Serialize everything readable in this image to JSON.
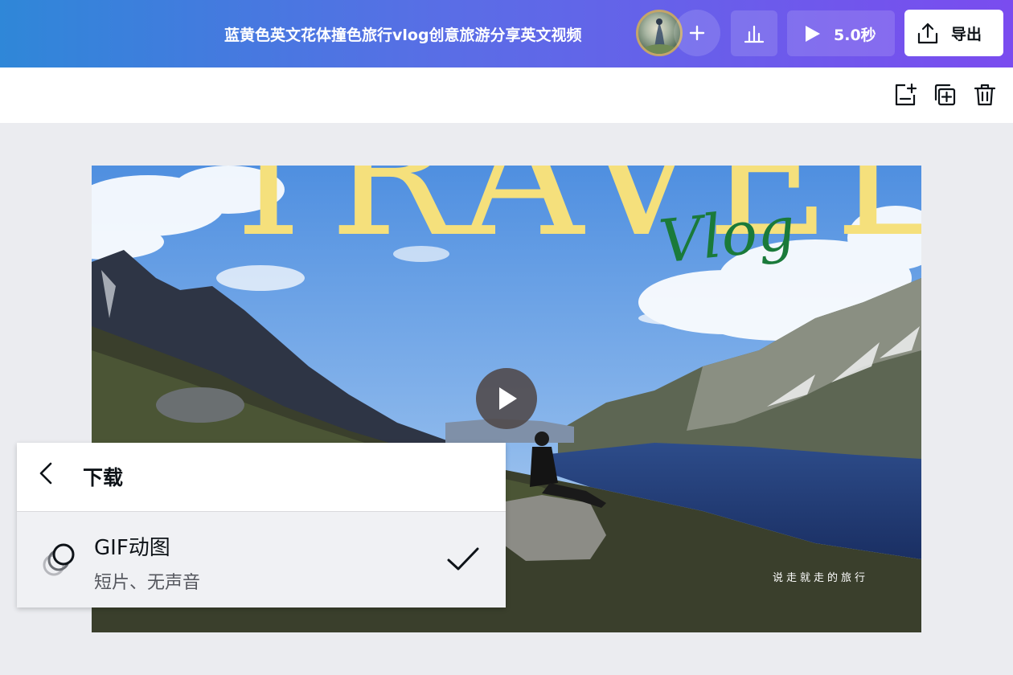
{
  "header": {
    "doc_title": "蓝黄色英文花体撞色旅行vlog创意旅游分享英文视频",
    "avatar_icon": "user-avatar",
    "add_icon": "plus-icon",
    "stats_icon": "bar-chart-icon",
    "play_icon": "play-icon",
    "duration": "5.0秒",
    "export_icon": "share-upload-icon",
    "export_label": "导出"
  },
  "page_toolbar": {
    "icons": [
      "add-page-icon",
      "duplicate-page-icon",
      "trash-icon"
    ]
  },
  "canvas": {
    "title_text": "TRAVEL",
    "script_text": "Vlog",
    "subtitle_text": "说走就走的旅行",
    "play_icon": "play-icon"
  },
  "download_panel": {
    "title": "下载",
    "back_icon": "chevron-left-icon",
    "option": {
      "name": "GIF动图",
      "description": "短片、无声音",
      "icon": "gif-rings-icon",
      "selected": true
    }
  },
  "colors": {
    "header_gradient_start": "#2f87d8",
    "header_gradient_end": "#7a4cef",
    "title_yellow": "#f5e07c",
    "script_green": "#1a7a3a"
  }
}
